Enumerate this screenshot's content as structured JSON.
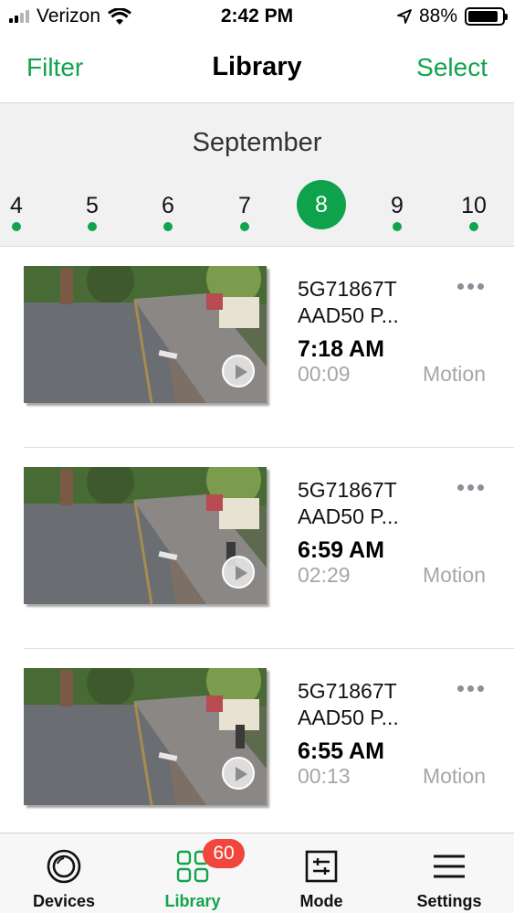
{
  "status_bar": {
    "carrier": "Verizon",
    "time": "2:42 PM",
    "battery": "88%",
    "battery_level": 0.88,
    "icons": [
      "signal-icon",
      "wifi-icon",
      "location-icon",
      "battery-icon"
    ]
  },
  "nav": {
    "left": "Filter",
    "title": "Library",
    "right": "Select"
  },
  "calendar": {
    "month": "September",
    "days": [
      {
        "label": "4",
        "has_clips": true
      },
      {
        "label": "5",
        "has_clips": true
      },
      {
        "label": "6",
        "has_clips": true
      },
      {
        "label": "7",
        "has_clips": true
      },
      {
        "label": "8",
        "has_clips": true,
        "selected": true
      },
      {
        "label": "9",
        "has_clips": true
      },
      {
        "label": "10",
        "has_clips": true
      }
    ]
  },
  "clips": [
    {
      "name_line1": "5G71867T",
      "name_line2": "AAD50 P...",
      "time": "7:18 AM",
      "duration": "00:09",
      "trigger": "Motion"
    },
    {
      "name_line1": "5G71867T",
      "name_line2": "AAD50 P...",
      "time": "6:59 AM",
      "duration": "02:29",
      "trigger": "Motion"
    },
    {
      "name_line1": "5G71867T",
      "name_line2": "AAD50 P...",
      "time": "6:55 AM",
      "duration": "00:13",
      "trigger": "Motion"
    }
  ],
  "tabs": [
    {
      "label": "Devices",
      "icon": "camera-lens-icon"
    },
    {
      "label": "Library",
      "icon": "grid-icon",
      "active": true,
      "badge": "60"
    },
    {
      "label": "Mode",
      "icon": "sliders-icon"
    },
    {
      "label": "Settings",
      "icon": "hamburger-menu-icon"
    }
  ],
  "colors": {
    "accent": "#12a44c",
    "badge": "#f0463c",
    "muted_text": "#a6a6a6"
  }
}
